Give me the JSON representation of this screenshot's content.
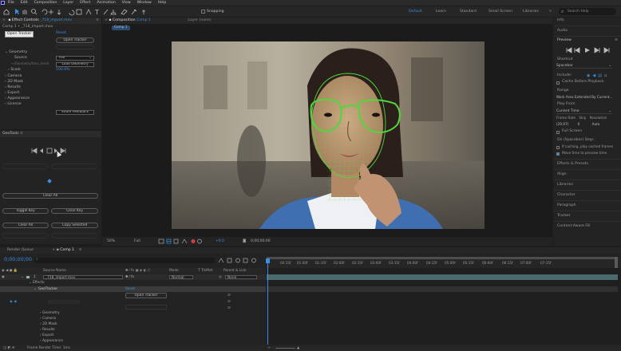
{
  "menubar": {
    "items": [
      "File",
      "Edit",
      "Composition",
      "Layer",
      "Effect",
      "Animation",
      "View",
      "Window",
      "Help"
    ]
  },
  "toolbar": {
    "snapping_label": "Snapping",
    "workspaces": [
      "Default",
      "Learn",
      "Standard",
      "Small Screen",
      "Libraries"
    ],
    "search_placeholder": "Search Help"
  },
  "effect_controls": {
    "tab_label": "Effect Controls",
    "tab_layer": "_718_import.mov",
    "breadcrumb": "Comp 1 • _718_import.mov",
    "tooltip": "Open Tracker",
    "reset_label": "Reset",
    "open_tracker_label": "Open Tracker",
    "geometry_label": "Geometry",
    "source_label": "Source",
    "source_value": "File",
    "load_geometry_label": "Load Geometry",
    "source_file": "~/Geometry/face_mesh",
    "scale_label": "Scale",
    "scale_value": "100.0%",
    "groups": [
      "Camera",
      "2D Mask",
      "Results",
      "Export",
      "Appearance",
      "License"
    ],
    "share_feedback_label": "Share Feedback"
  },
  "geartools": {
    "tab_label": "GeoTools",
    "clear_all_label": "Clear All",
    "toggle_label": "Toggle Key",
    "clear_key_label": "Clear Key",
    "clear_sel_label": "Clear All",
    "copy_label": "Copy Selected"
  },
  "composition": {
    "tab_label": "Composition",
    "tab_comp": "Comp 1",
    "layer_tab": "Layer (none)",
    "comp_chip": "Comp 1",
    "zoom": "50%",
    "quality": "Full",
    "exposure": "+0.0",
    "timecode": "0;00;00;00"
  },
  "right_panel": {
    "info_label": "Info",
    "audio_label": "Audio",
    "preview_label": "Preview",
    "shortcut_label": "Shortcut",
    "shortcut_value": "Spacebar",
    "include_label": "Include:",
    "cache_label": "Cache Before Playback",
    "range_label": "Range",
    "range_value": "Work Area Extended By Current...",
    "play_from_label": "Play From",
    "play_from_value": "Current Time",
    "frame_rate_label": "Frame Rate",
    "skip_label": "Skip",
    "resolution_label": "Resolution",
    "frame_rate_value": "(29.97)",
    "skip_value": "0",
    "resolution_value": "Auto",
    "full_screen_label": "Full Screen",
    "on_stop_label": "On (Spacebar) Stop:",
    "if_caching_label": "If caching, play cached frames",
    "move_time_label": "Move time to preview time",
    "panels": [
      "Effects & Presets",
      "Align",
      "Libraries",
      "Character",
      "Paragraph",
      "Tracker",
      "Content-Aware Fill"
    ]
  },
  "timeline": {
    "render_queue_label": "Render Queue",
    "comp_tab": "Comp 1",
    "timecode": "0;00;00;00",
    "col_source": "Source Name",
    "col_mode": "Mode",
    "col_trkmat": "T TrkMat",
    "col_parent": "Parent & Link",
    "layer_num": "1",
    "layer_name": "_718_import.mov",
    "layer_mode": "Normal",
    "layer_parent": "None",
    "effects_label": "Effects",
    "effect_name": "GeoTracker",
    "reset_label": "Reset",
    "open_tracker_label": "Open Tracker",
    "groups": [
      "Geometry",
      "Camera",
      "2D Mask",
      "Results",
      "Export",
      "Appearance"
    ],
    "ticks": [
      "00:15f",
      "01:00f",
      "01:15f",
      "02:00f",
      "02:15f",
      "03:00f",
      "03:15f",
      "04:00f",
      "04:15f",
      "05:00f",
      "05:15f",
      "06:00f",
      "06:15f",
      "07:00f",
      "07:15f"
    ],
    "status": "Frame Render Time: 1ms"
  },
  "colors": {
    "accent": "#3b8ee0",
    "mesh": "#4fd83a",
    "timeline_track": "#4a6b6e"
  }
}
